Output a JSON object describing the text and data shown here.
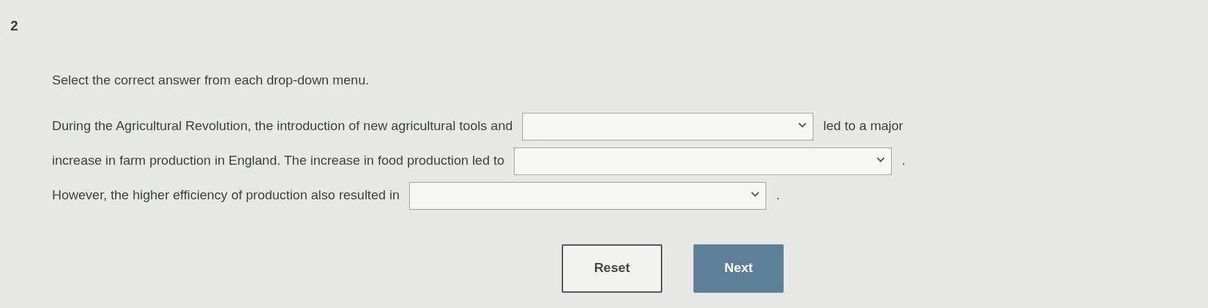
{
  "question_number": "2",
  "instruction": "Select the correct answer from each drop-down menu.",
  "lines": [
    [
      {
        "kind": "text",
        "text": "During the Agricultural Revolution, the introduction of new agricultural tools and"
      },
      {
        "kind": "dropdown"
      },
      {
        "kind": "text",
        "text": "led to a major"
      }
    ],
    [
      {
        "kind": "text",
        "text": "increase in farm production in England. The increase in food production led to"
      },
      {
        "kind": "dropdown"
      },
      {
        "kind": "text",
        "text": "."
      }
    ],
    [
      {
        "kind": "text",
        "text": "However, the higher efficiency of production also resulted in"
      },
      {
        "kind": "dropdown"
      },
      {
        "kind": "text",
        "text": "."
      }
    ]
  ],
  "buttons": [
    {
      "label": "Reset",
      "kind": "outline"
    },
    {
      "label": "Next",
      "kind": "primary"
    }
  ]
}
